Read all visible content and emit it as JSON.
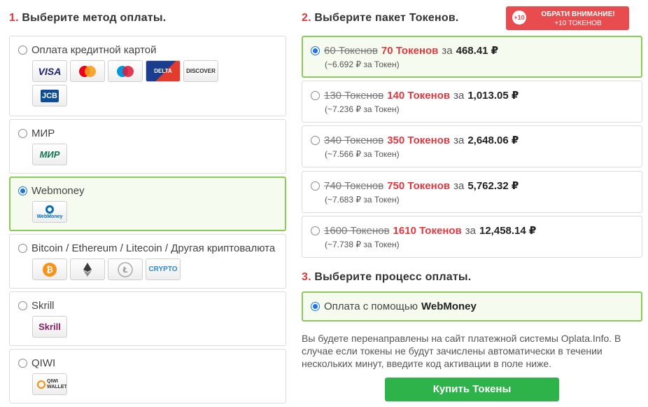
{
  "payment_methods": {
    "step_number": "1.",
    "title": "Выберите метод оплаты.",
    "items": [
      {
        "label": "Оплата кредитной картой",
        "selected": false,
        "logos": [
          "visa-logo",
          "mastercard-logo",
          "maestro-logo",
          "delta-logo",
          "discover-logo",
          "jcb-logo"
        ]
      },
      {
        "label": "МИР",
        "selected": false,
        "logos": [
          "mir-logo"
        ]
      },
      {
        "label": "Webmoney",
        "selected": true,
        "logos": [
          "webmoney-logo"
        ]
      },
      {
        "label": "Bitcoin / Ethereum / Litecoin / Другая криптовалюта",
        "selected": false,
        "logos": [
          "bitcoin-logo",
          "ethereum-logo",
          "litecoin-logo",
          "crypto-logo"
        ]
      },
      {
        "label": "Skrill",
        "selected": false,
        "logos": [
          "skrill-logo"
        ]
      },
      {
        "label": "QIWI",
        "selected": false,
        "logos": [
          "qiwi-wallet-logo"
        ]
      }
    ],
    "logo_text": {
      "visa": "VISA",
      "delta": "DELTA",
      "discover": "DISCOVER",
      "jcb": "JCB",
      "mir": "МИР",
      "webmoney": "WebMoney",
      "crypto": "CRYPTO",
      "skrill": "Skrill",
      "qiwi": "QIWI WALLET"
    }
  },
  "token_packages": {
    "step_number": "2.",
    "title": "Выберите пакет Токенов.",
    "notice": {
      "badge": "+10",
      "line1": "ОБРАТИ ВНИМАНИЕ!",
      "line2": "+10 ТОКЕНОВ"
    },
    "items": [
      {
        "old": "60 Токенов",
        "new": "70 Токенов",
        "za": "за",
        "price": "468.41 ₽",
        "per_token": "(~6.692 ₽ за Токен)",
        "selected": true
      },
      {
        "old": "130 Токенов",
        "new": "140 Токенов",
        "za": "за",
        "price": "1,013.05 ₽",
        "per_token": "(~7.236 ₽ за Токен)",
        "selected": false
      },
      {
        "old": "340 Токенов",
        "new": "350 Токенов",
        "za": "за",
        "price": "2,648.06 ₽",
        "per_token": "(~7.566 ₽ за Токен)",
        "selected": false
      },
      {
        "old": "740 Токенов",
        "new": "750 Токенов",
        "za": "за",
        "price": "5,762.32 ₽",
        "per_token": "(~7.683 ₽ за Токен)",
        "selected": false
      },
      {
        "old": "1600 Токенов",
        "new": "1610 Токенов",
        "za": "за",
        "price": "12,458.14 ₽",
        "per_token": "(~7.738 ₽ за Токен)",
        "selected": false
      }
    ]
  },
  "payment_process": {
    "step_number": "3.",
    "title": "Выберите процесс оплаты.",
    "option_text": "Оплата с помощью",
    "option_method": "WebMoney",
    "info": "Вы будете перенаправлены на сайт платежной системы Oplata.Info. В случае если токены не будут зачислены автоматически в течении нескольких минут, введите код активации в поле ниже.",
    "buy_label": "Купить Токены"
  },
  "colors": {
    "accent_red": "#e0383e",
    "selected_border": "#8ccb57",
    "buy_button": "#2db34a",
    "radio_blue": "#1a73e8"
  }
}
